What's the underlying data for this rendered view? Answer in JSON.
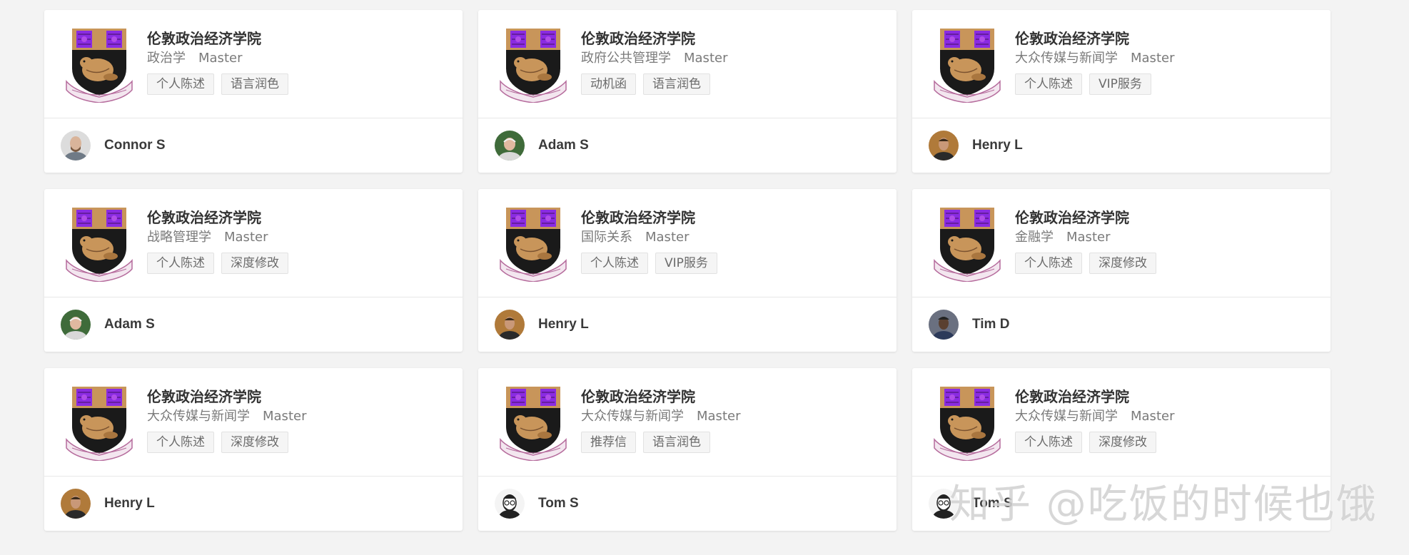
{
  "cards": [
    {
      "school": "伦敦政治经济学院",
      "major": "政治学",
      "degree": "Master",
      "tags": [
        "个人陈述",
        "语言润色"
      ],
      "mentor": "Connor S",
      "avatar": "avatar-light-bald"
    },
    {
      "school": "伦敦政治经济学院",
      "major": "政府公共管理学",
      "degree": "Master",
      "tags": [
        "动机函",
        "语言润色"
      ],
      "mentor": "Adam S",
      "avatar": "avatar-green-bg"
    },
    {
      "school": "伦敦政治经济学院",
      "major": "大众传媒与新闻学",
      "degree": "Master",
      "tags": [
        "个人陈述",
        "VIP服务"
      ],
      "mentor": "Henry L",
      "avatar": "avatar-warm-bg"
    },
    {
      "school": "伦敦政治经济学院",
      "major": "战略管理学",
      "degree": "Master",
      "tags": [
        "个人陈述",
        "深度修改"
      ],
      "mentor": "Adam S",
      "avatar": "avatar-green-bg"
    },
    {
      "school": "伦敦政治经济学院",
      "major": "国际关系",
      "degree": "Master",
      "tags": [
        "个人陈述",
        "VIP服务"
      ],
      "mentor": "Henry L",
      "avatar": "avatar-warm-bg"
    },
    {
      "school": "伦敦政治经济学院",
      "major": "金融学",
      "degree": "Master",
      "tags": [
        "个人陈述",
        "深度修改"
      ],
      "mentor": "Tim D",
      "avatar": "avatar-dark-bg"
    },
    {
      "school": "伦敦政治经济学院",
      "major": "大众传媒与新闻学",
      "degree": "Master",
      "tags": [
        "个人陈述",
        "深度修改"
      ],
      "mentor": "Henry L",
      "avatar": "avatar-warm-bg"
    },
    {
      "school": "伦敦政治经济学院",
      "major": "大众传媒与新闻学",
      "degree": "Master",
      "tags": [
        "推荐信",
        "语言润色"
      ],
      "mentor": "Tom S",
      "avatar": "avatar-bw-sketch"
    },
    {
      "school": "伦敦政治经济学院",
      "major": "大众传媒与新闻学",
      "degree": "Master",
      "tags": [
        "个人陈述",
        "深度修改"
      ],
      "mentor": "Tom S",
      "avatar": "avatar-bw-sketch"
    }
  ],
  "watermark": "知乎 @吃饭的时候也饿",
  "colors": {
    "crest_purple": "#8a2be2",
    "crest_gold": "#c8955a",
    "crest_black": "#1a1a1a",
    "ribbon_pink": "#d4a0c0",
    "page_background": "#f3f3f3"
  }
}
